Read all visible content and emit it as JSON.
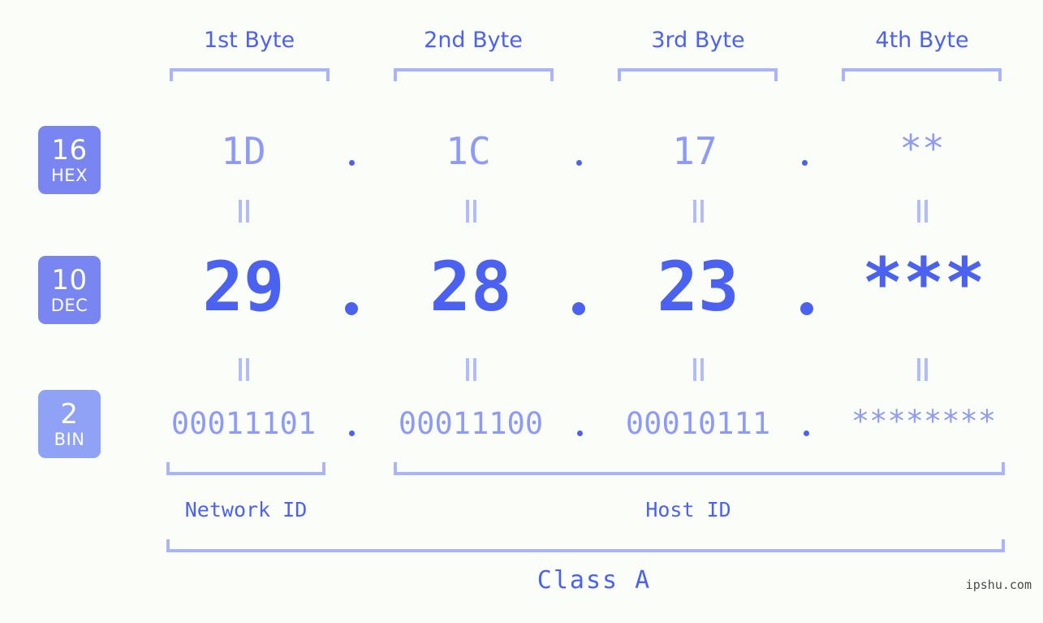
{
  "background_color": "#fbfdf9",
  "accent_color": "#4b62f0",
  "accent_light_color": "#8d9bf7",
  "bracket_color": "#aab4fb",
  "byte_headers": [
    {
      "label": "1st Byte"
    },
    {
      "label": "2nd Byte"
    },
    {
      "label": "3rd Byte"
    },
    {
      "label": "4th Byte"
    }
  ],
  "bases": [
    {
      "number": "16",
      "name": "HEX",
      "color": "#7986f2"
    },
    {
      "number": "10",
      "name": "DEC",
      "color": "#7986f2"
    },
    {
      "number": "2",
      "name": "BIN",
      "color": "#8fa2f5"
    }
  ],
  "rows": {
    "hex": {
      "values": [
        "1D",
        "1C",
        "17",
        "**"
      ],
      "separator": "."
    },
    "dec": {
      "values": [
        "29",
        "28",
        "23",
        "***"
      ],
      "separator": "."
    },
    "bin": {
      "values": [
        "00011101",
        "00011100",
        "00010111",
        "********"
      ],
      "separator": "."
    }
  },
  "equals_markers": [
    "=",
    "=",
    "=",
    "=",
    "=",
    "=",
    "=",
    "="
  ],
  "sections": {
    "network_id": "Network ID",
    "host_id": "Host ID",
    "class": "Class A"
  },
  "watermark": "ipshu.com"
}
